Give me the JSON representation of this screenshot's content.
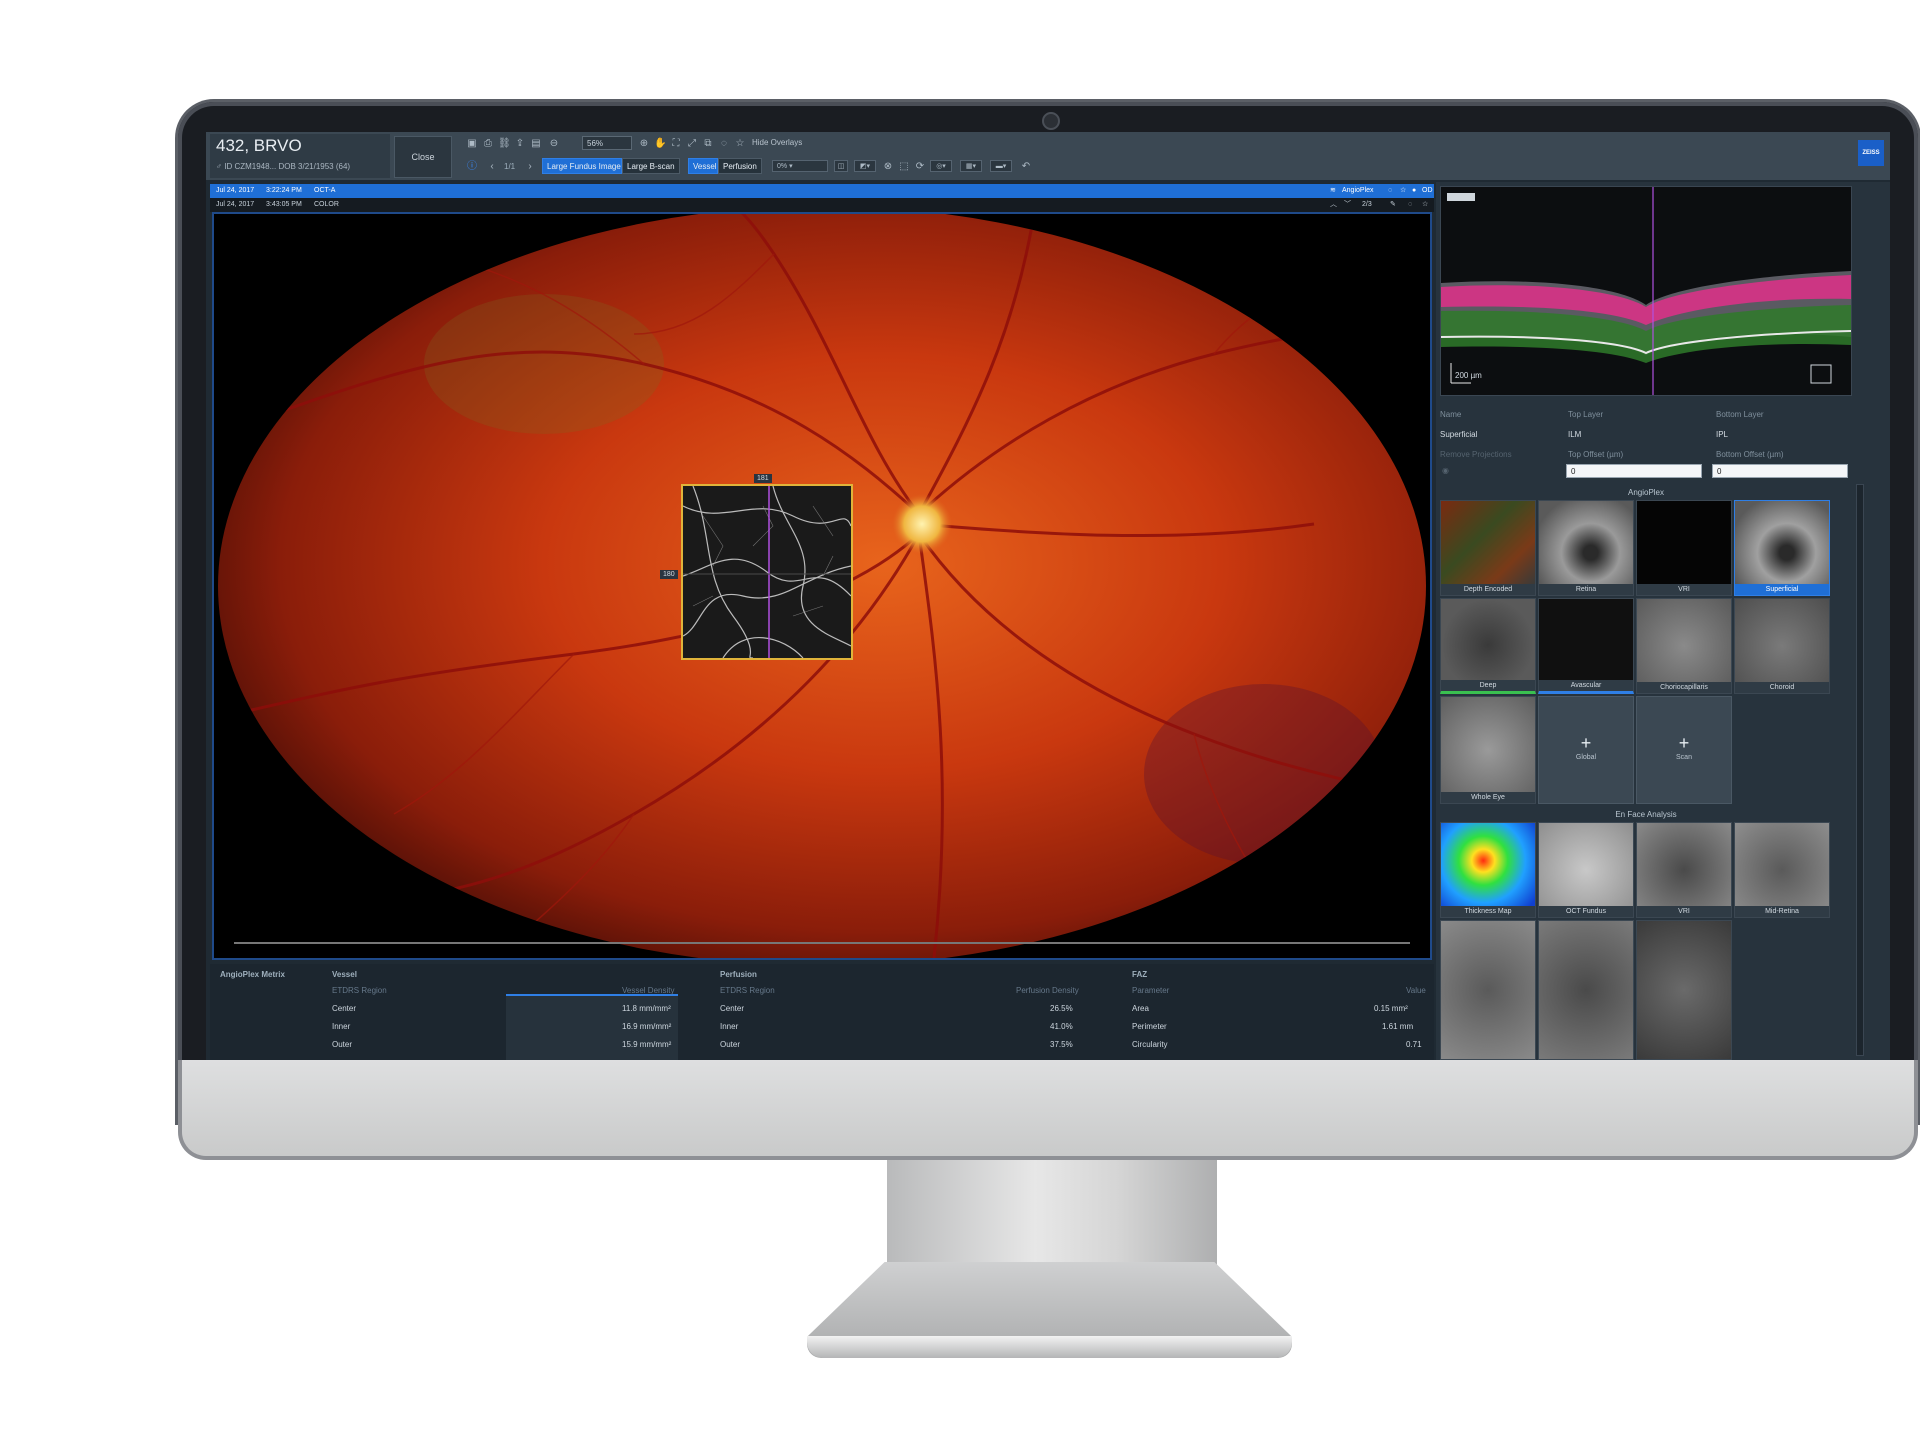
{
  "header": {
    "patient_name": "432, BRVO",
    "patient_info": "♂ ID CZM1948...   DOB 3/21/1953  (64)",
    "close_label": "Close",
    "zoom": "56%",
    "hide_overlays": "Hide Overlays",
    "page_indicator": "1/1",
    "view_tabs": [
      "Large Fundus Image",
      "Large B-scan"
    ],
    "mode_tabs": [
      "Vessel",
      "Perfusion"
    ],
    "opacity": "0%",
    "brand": "ZEISS"
  },
  "scan_bar_1": {
    "date": "Jul 24, 2017",
    "time": "3:22:24 PM",
    "type": "OCT-A",
    "module": "AngioPlex",
    "eye": "OD"
  },
  "scan_bar_2": {
    "date": "Jul 24, 2017",
    "time": "3:43:05 PM",
    "type": "COLOR",
    "counter": "2/3"
  },
  "overlay": {
    "tag_top": "181",
    "tag_left": "180"
  },
  "metrics": {
    "title": "AngioPlex Metrix",
    "vessel": {
      "header": "Vessel",
      "col_region": "ETDRS Region",
      "col_value": "Vessel Density",
      "rows": [
        [
          "Center",
          "11.8 mm/mm²"
        ],
        [
          "Inner",
          "16.9 mm/mm²"
        ],
        [
          "Outer",
          "15.9 mm/mm²"
        ]
      ]
    },
    "perfusion": {
      "header": "Perfusion",
      "col_region": "ETDRS Region",
      "col_value": "Perfusion Density",
      "rows": [
        [
          "Center",
          "26.5%"
        ],
        [
          "Inner",
          "41.0%"
        ],
        [
          "Outer",
          "37.5%"
        ]
      ]
    },
    "faz": {
      "header": "FAZ",
      "col_param": "Parameter",
      "col_value": "Value",
      "rows": [
        [
          "Area",
          "0.15 mm²"
        ],
        [
          "Perimeter",
          "1.61 mm"
        ],
        [
          "Circularity",
          "0.71"
        ]
      ]
    }
  },
  "bscan": {
    "scale": "200 µm"
  },
  "layers": {
    "name_label": "Name",
    "top_label": "Top Layer",
    "bottom_label": "Bottom Layer",
    "name": "Superficial",
    "top": "ILM",
    "bottom": "IPL",
    "remove_proj": "Remove Projections",
    "top_offset_label": "Top Offset (µm)",
    "bottom_offset_label": "Bottom Offset (µm)",
    "top_offset": "0",
    "bottom_offset": "0"
  },
  "angioplex": {
    "title": "AngioPlex",
    "tiles": [
      "Depth Encoded",
      "Retina",
      "VRI",
      "Superficial",
      "Deep",
      "Avascular",
      "Choriocapillaris",
      "Choroid",
      "Whole Eye"
    ],
    "selected": "Superficial",
    "add_global": "Global",
    "add_scan": "Scan"
  },
  "enface": {
    "title": "En Face Analysis",
    "tiles": [
      "Thickness Map",
      "OCT Fundus",
      "VRI",
      "Mid-Retina"
    ]
  },
  "colors": {
    "accent": "#1f6fd6",
    "toolbar": "#3b4853",
    "panel": "#27333d",
    "roi": "#e0b43a"
  }
}
